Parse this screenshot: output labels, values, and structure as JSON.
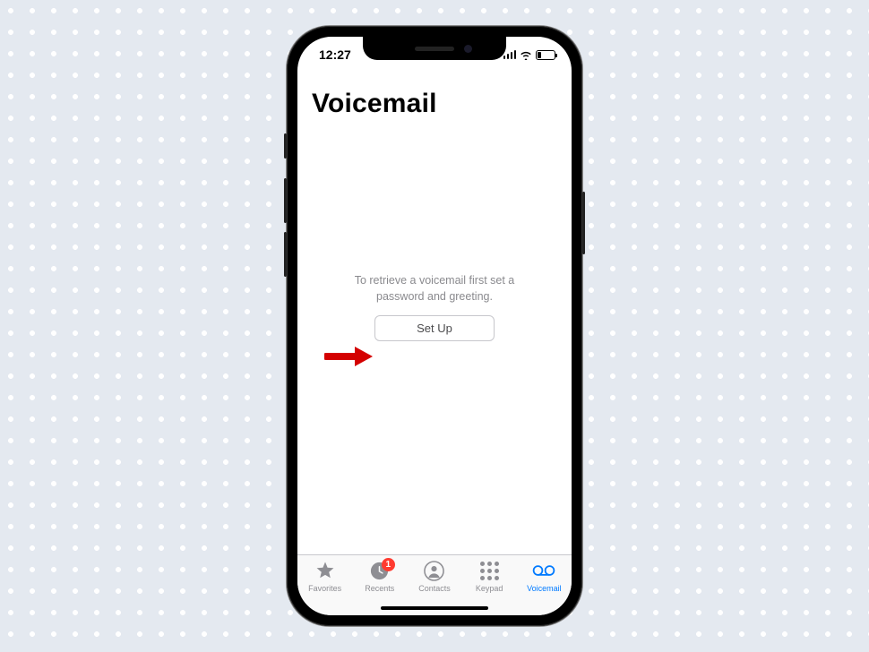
{
  "status": {
    "time": "12:27"
  },
  "page": {
    "title": "Voicemail",
    "instruction": "To retrieve a voicemail first set a password and greeting.",
    "setup_button": "Set Up"
  },
  "tabs": {
    "favorites": "Favorites",
    "recents": "Recents",
    "recents_badge": "1",
    "contacts": "Contacts",
    "keypad": "Keypad",
    "voicemail": "Voicemail"
  },
  "colors": {
    "accent": "#007aff",
    "inactive": "#8e8e93",
    "badge": "#ff3b30"
  }
}
